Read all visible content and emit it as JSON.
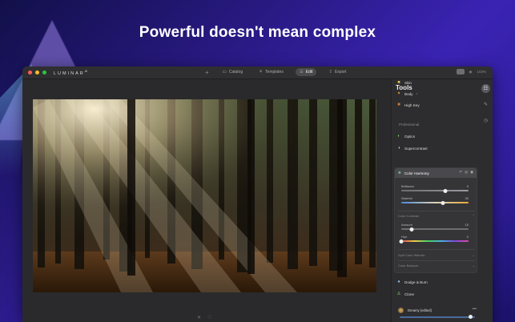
{
  "headline": "Powerful doesn't mean complex",
  "app": {
    "name": "LUMINAR",
    "version_mark": "AI",
    "nav": [
      {
        "label": "Catalog",
        "icon": "folder-icon",
        "active": false
      },
      {
        "label": "Templates",
        "icon": "templates-icon",
        "active": false
      },
      {
        "label": "Edit",
        "icon": "sliders-icon",
        "active": true
      },
      {
        "label": "Export",
        "icon": "export-icon",
        "active": false
      }
    ],
    "zoom": "103%"
  },
  "panel": {
    "title": "Tools",
    "tools_top": [
      {
        "label": "Skin",
        "icon": "skin-icon",
        "color": "#e9c35a"
      },
      {
        "label": "Body",
        "icon": "body-icon",
        "color": "#e9a33a"
      },
      {
        "label": "High Key",
        "icon": "highkey-icon",
        "color": "#d87a3a"
      }
    ],
    "section_professional": "Professional",
    "tools_pro": [
      {
        "label": "Optics",
        "icon": "optics-icon",
        "color": "#7fd36a"
      },
      {
        "label": "Supercontrast",
        "icon": "supercontrast-icon",
        "color": "#cfcfcf"
      }
    ],
    "harmony": {
      "title": "Color Harmony",
      "sliders": [
        {
          "label": "Brilliance",
          "value": "9",
          "fraction": 0.65
        },
        {
          "label": "Warmth",
          "value": "30",
          "fraction": 0.62
        }
      ],
      "color_contrast": "Color Contrast",
      "contrast_sliders": [
        {
          "label": "Amount",
          "value": "15",
          "fraction": 0.15
        },
        {
          "label": "Hue",
          "value": "0",
          "fraction": 0.0
        }
      ],
      "split_color_warmth": "Split Color Warmth",
      "color_balance": "Color Balance"
    },
    "tools_bottom": [
      {
        "label": "Dodge & Burn",
        "icon": "dodge-icon",
        "color": "#8ec3f0"
      },
      {
        "label": "Clone",
        "icon": "clone-icon",
        "color": "#7fd36a"
      }
    ],
    "preset": {
      "label": "Dreamy (edited)",
      "more": "•••",
      "fraction": 0.98
    }
  },
  "colors": {
    "accent": "#4a6a9a",
    "dot_red": "#ff5f57",
    "dot_yellow": "#febc2e",
    "dot_green": "#28c840"
  }
}
